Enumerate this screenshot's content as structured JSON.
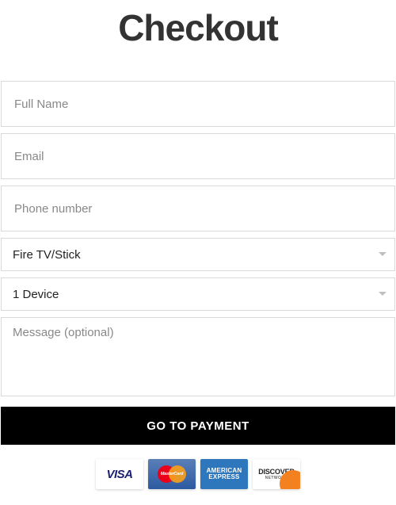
{
  "title": "Checkout",
  "form": {
    "full_name": {
      "placeholder": "Full Name",
      "value": ""
    },
    "email": {
      "placeholder": "Email",
      "value": ""
    },
    "phone": {
      "placeholder": "Phone number",
      "value": ""
    },
    "device_type": {
      "selected": "Fire TV/Stick"
    },
    "device_count": {
      "selected": "1 Device"
    },
    "message": {
      "placeholder": "Message (optional)",
      "value": ""
    },
    "submit_label": "GO TO PAYMENT"
  },
  "payment_logos": {
    "visa": "VISA",
    "mastercard": "MasterCard",
    "amex_line1": "AMERICAN",
    "amex_line2": "EXPRESS",
    "discover": "DISCOVER",
    "discover_sub": "NETWORK"
  }
}
